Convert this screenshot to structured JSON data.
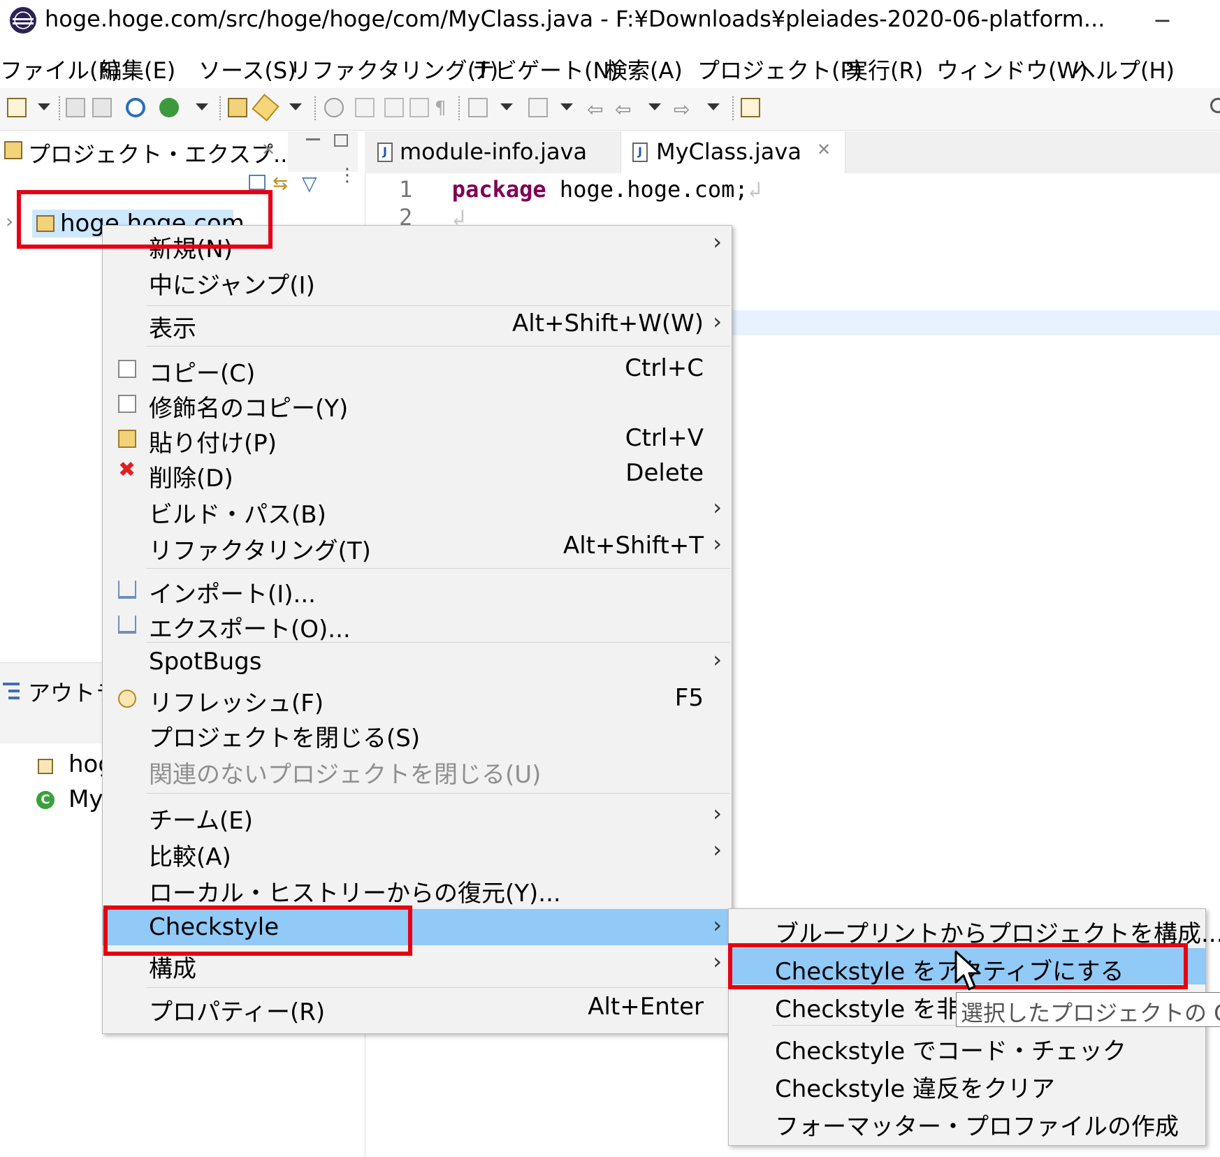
{
  "window": {
    "title": "hoge.hoge.com/src/hoge/hoge/com/MyClass.java - F:¥Downloads¥pleiades-2020-06-platform...",
    "minimize": "−"
  },
  "menubar": [
    "ファイル(F)",
    "編集(E)",
    "ソース(S)",
    "リファクタリング(T)",
    "ナビゲート(N)",
    "検索(A)",
    "プロジェクト(P)",
    "実行(R)",
    "ウィンドウ(W)",
    "ヘルプ(H)"
  ],
  "explorer": {
    "tab_label": "プロジェクト・エクスプ...",
    "project_name": "hoge.hoge.com"
  },
  "outline": {
    "tab_label": "アウトラ",
    "items": [
      "hog",
      "My"
    ]
  },
  "editor": {
    "tabs": [
      "module-info.java",
      "MyClass.java"
    ],
    "lines": [
      {
        "no": "1",
        "keyword": "package",
        "text": " hoge.hoge.com;"
      },
      {
        "no": "2",
        "keyword": "",
        "text": ""
      }
    ]
  },
  "context_menu": {
    "items": [
      {
        "label": "新規(N)",
        "shortcut": "",
        "arrow": "›"
      },
      {
        "label": "中にジャンプ(I)",
        "shortcut": "",
        "arrow": ""
      },
      {
        "label": "表示",
        "shortcut": "Alt+Shift+W(W)",
        "arrow": "›"
      },
      {
        "label": "コピー(C)",
        "shortcut": "Ctrl+C",
        "arrow": ""
      },
      {
        "label": "修飾名のコピー(Y)",
        "shortcut": "",
        "arrow": ""
      },
      {
        "label": "貼り付け(P)",
        "shortcut": "Ctrl+V",
        "arrow": ""
      },
      {
        "label": "削除(D)",
        "shortcut": "Delete",
        "arrow": ""
      },
      {
        "label": "ビルド・パス(B)",
        "shortcut": "",
        "arrow": "›"
      },
      {
        "label": "リファクタリング(T)",
        "shortcut": "Alt+Shift+T",
        "arrow": "›"
      },
      {
        "label": "インポート(I)...",
        "shortcut": "",
        "arrow": ""
      },
      {
        "label": "エクスポート(O)...",
        "shortcut": "",
        "arrow": ""
      },
      {
        "label": "SpotBugs",
        "shortcut": "",
        "arrow": "›"
      },
      {
        "label": "リフレッシュ(F)",
        "shortcut": "F5",
        "arrow": ""
      },
      {
        "label": "プロジェクトを閉じる(S)",
        "shortcut": "",
        "arrow": ""
      },
      {
        "label": "関連のないプロジェクトを閉じる(U)",
        "shortcut": "",
        "arrow": ""
      },
      {
        "label": "チーム(E)",
        "shortcut": "",
        "arrow": "›"
      },
      {
        "label": "比較(A)",
        "shortcut": "",
        "arrow": "›"
      },
      {
        "label": "ローカル・ヒストリーからの復元(Y)...",
        "shortcut": "",
        "arrow": ""
      },
      {
        "label": "Checkstyle",
        "shortcut": "",
        "arrow": "›"
      },
      {
        "label": "構成",
        "shortcut": "",
        "arrow": "›"
      },
      {
        "label": "プロパティー(R)",
        "shortcut": "Alt+Enter",
        "arrow": ""
      }
    ]
  },
  "checkstyle_submenu": {
    "items": [
      "ブループリントからプロジェクトを構成...",
      "Checkstyle をアクティブにする",
      "Checkstyle を非ア",
      "Checkstyle でコード・チェック",
      "Checkstyle 違反をクリア",
      "フォーマッター・プロファイルの作成"
    ]
  },
  "tooltip": "選択したプロジェクトの Che",
  "colors": {
    "selection": "#91c9f7",
    "annotation_red": "#e60012",
    "keyword": "#7f0055",
    "menu_bg": "#f2f2f2"
  }
}
